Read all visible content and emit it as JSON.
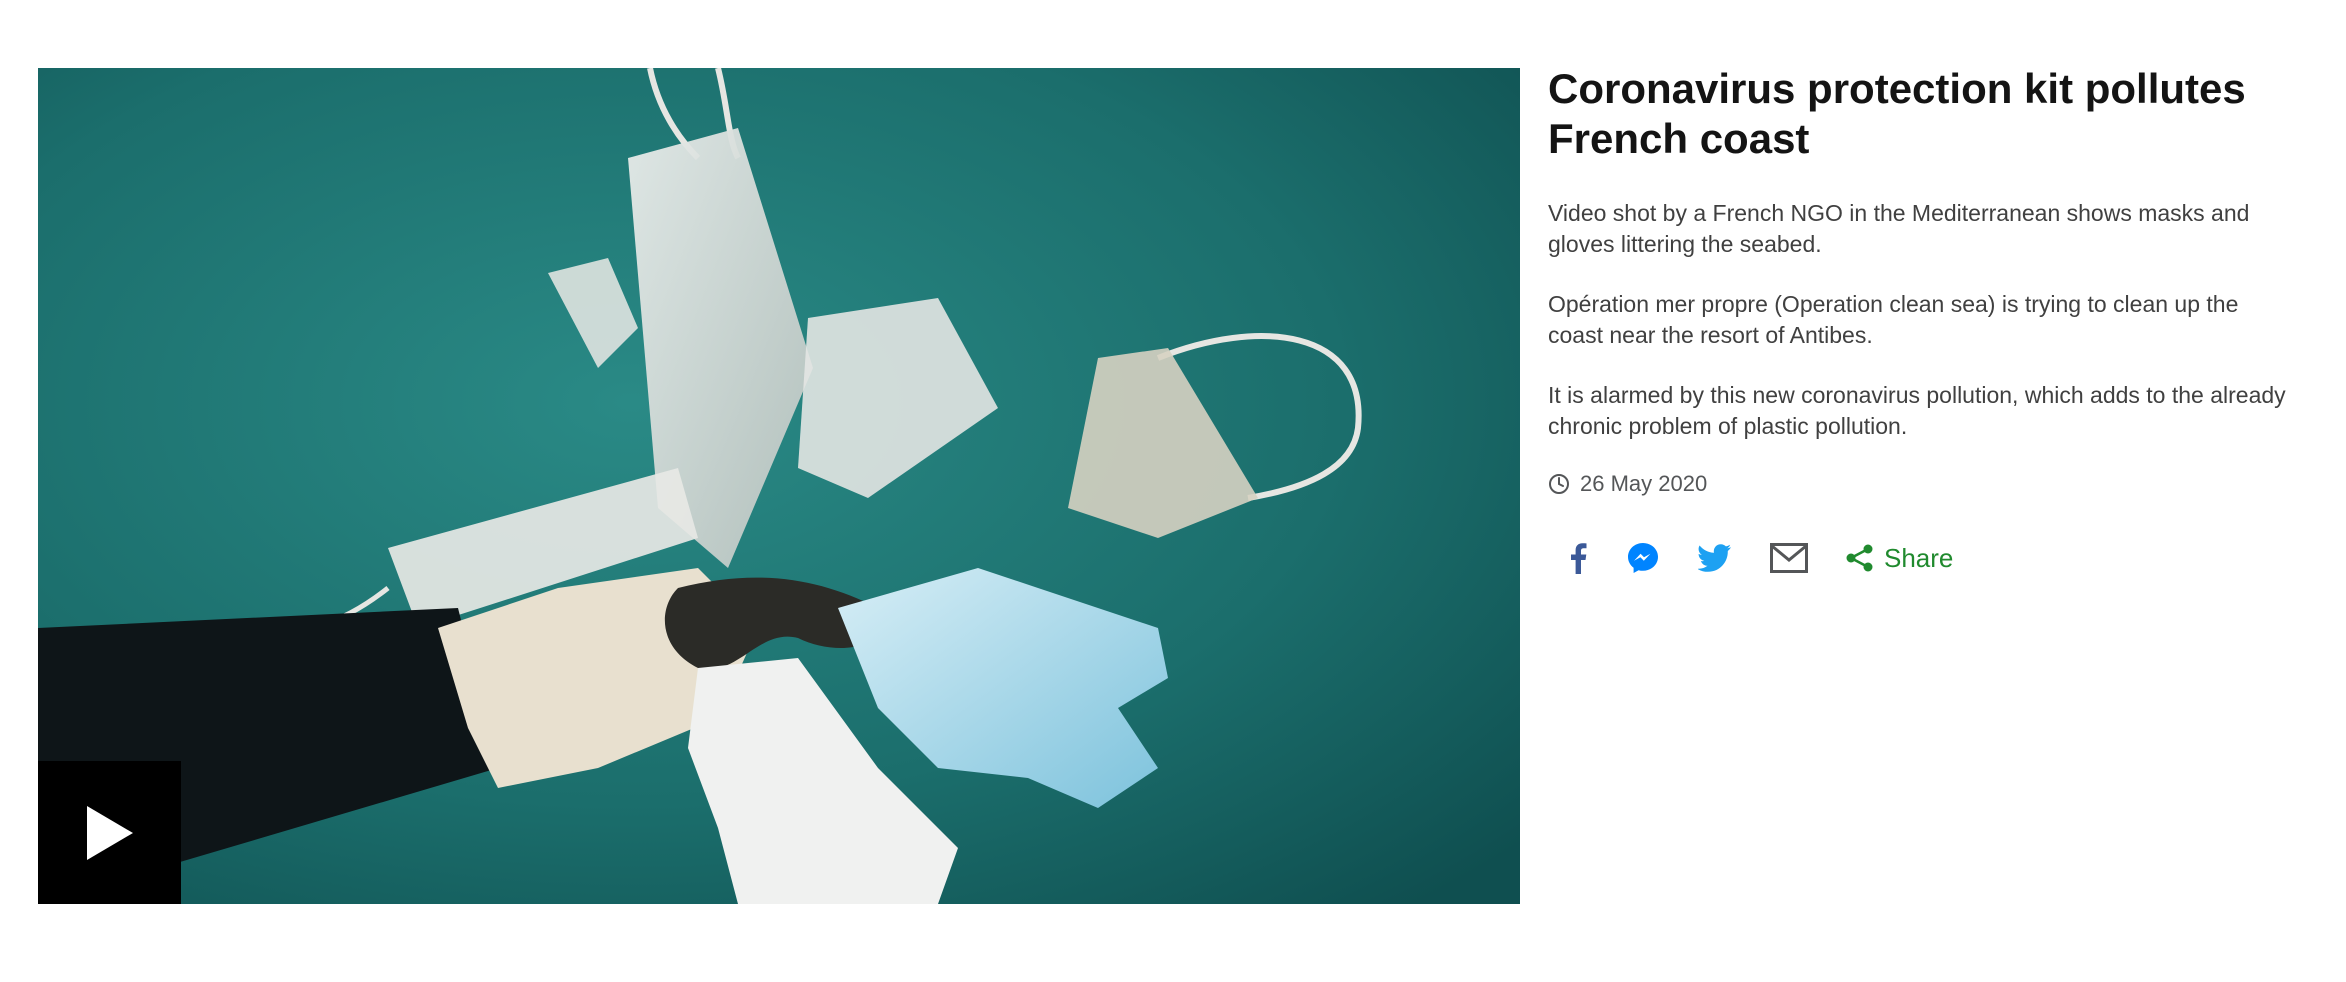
{
  "video": {
    "icons": {
      "play": "play-icon"
    }
  },
  "article": {
    "headline": "Coronavirus protection kit pollutes French coast",
    "paragraphs": [
      "Video shot by a French NGO in the Mediterranean shows masks and gloves littering the seabed.",
      "Opération mer propre (Operation clean sea) is trying to clean up the coast near the resort of Antibes.",
      "It is alarmed by this new coronavirus pollution, which adds to the already chronic problem of plastic pollution."
    ],
    "date": "26 May 2020"
  },
  "share": {
    "label": "Share",
    "icons": [
      "facebook-icon",
      "messenger-icon",
      "twitter-icon",
      "email-icon",
      "share-icon"
    ]
  },
  "colors": {
    "water": "#1b6e6c",
    "share_green": "#208a2e",
    "facebook": "#3b5998",
    "messenger": "#0084ff",
    "twitter": "#1da1f2",
    "email": "#545658"
  }
}
